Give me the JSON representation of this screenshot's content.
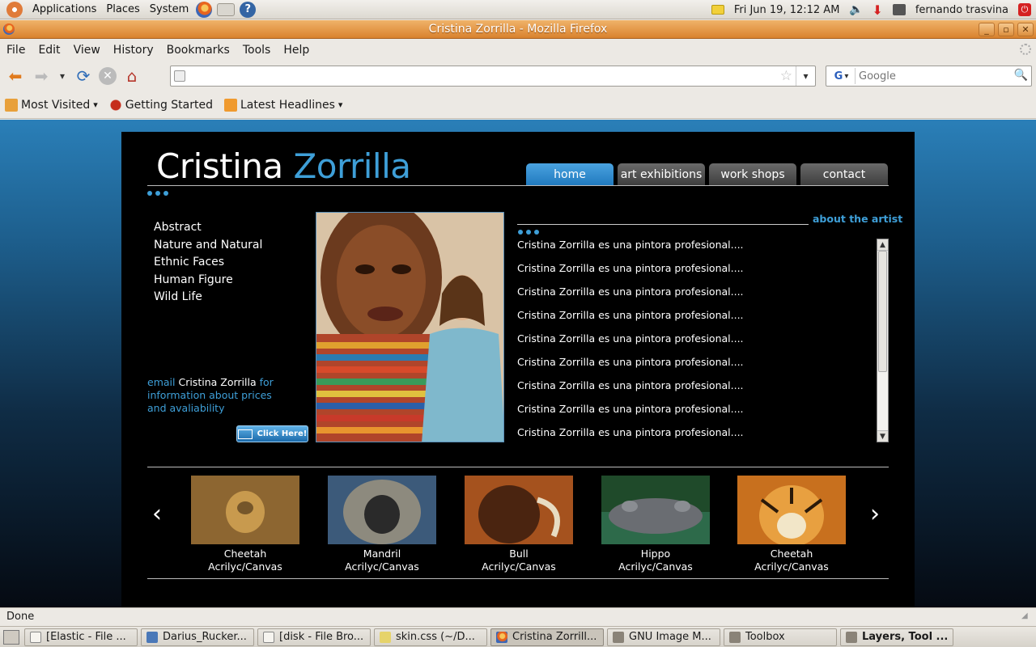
{
  "panel": {
    "menus": [
      "Applications",
      "Places",
      "System"
    ],
    "clock": "Fri Jun 19, 12:12 AM",
    "user": "fernando trasvina"
  },
  "window": {
    "title": "Cristina Zorrilla - Mozilla Firefox",
    "menu": [
      "File",
      "Edit",
      "View",
      "History",
      "Bookmarks",
      "Tools",
      "Help"
    ]
  },
  "nav": {
    "url": "",
    "search_placeholder": "Google",
    "search_engine": "G"
  },
  "bookmarks": [
    {
      "label": "Most Visited",
      "icon": "most-visited-icon",
      "dropdown": true
    },
    {
      "label": "Getting Started",
      "icon": "getting-started-icon",
      "dropdown": false
    },
    {
      "label": "Latest Headlines",
      "icon": "rss-icon",
      "dropdown": true
    }
  ],
  "site": {
    "logo_first": "Cristina",
    "logo_last": "Zorrilla",
    "tabs": [
      "home",
      "art exhibitions",
      "work shops",
      "contact"
    ],
    "active_tab": "home",
    "categories": [
      "Abstract",
      "Nature and Natural",
      "Ethnic Faces",
      "Human Figure",
      "Wild Life"
    ],
    "email_label": "email",
    "email_name": "Cristina Zorrilla",
    "email_rest": "for information about prices and avaliability",
    "click_button": "Click Here!",
    "about_title": "about the artist",
    "about_lines": [
      "Cristina Zorrilla es una pintora profesional....",
      "Cristina Zorrilla es una pintora profesional....",
      "Cristina Zorrilla es una pintora profesional....",
      "Cristina Zorrilla es una pintora profesional....",
      "Cristina Zorrilla es una pintora profesional....",
      "Cristina Zorrilla es una pintora profesional....",
      "Cristina Zorrilla es una pintora profesional....",
      "Cristina Zorrilla es una pintora profesional....",
      "Cristina Zorrilla es una pintora profesional...."
    ],
    "gallery": [
      {
        "title": "Cheetah",
        "medium": "Acrilyc/Canvas",
        "colors": [
          "#6b4a22",
          "#b78a44",
          "#3d2a12"
        ]
      },
      {
        "title": "Mandril",
        "medium": "Acrilyc/Canvas",
        "colors": [
          "#3c5a7a",
          "#8d8a7e",
          "#2a2a2a"
        ]
      },
      {
        "title": "Bull",
        "medium": "Acrilyc/Canvas",
        "colors": [
          "#4a2410",
          "#a5521e",
          "#d68c36"
        ]
      },
      {
        "title": "Hippo",
        "medium": "Acrilyc/Canvas",
        "colors": [
          "#1f4a2a",
          "#6a6d72",
          "#2d7a3a"
        ]
      },
      {
        "title": "Cheetah",
        "medium": "Acrilyc/Canvas",
        "colors": [
          "#c8701e",
          "#f2e6c8",
          "#2a1a0a"
        ]
      }
    ]
  },
  "status": "Done",
  "taskbar": [
    {
      "label": "[Elastic - File ...",
      "icon": "file-browser-icon",
      "active": false,
      "bold": false
    },
    {
      "label": "Darius_Rucker...",
      "icon": "music-player-icon",
      "active": false,
      "bold": false
    },
    {
      "label": "[disk - File Bro...",
      "icon": "file-browser-icon",
      "active": false,
      "bold": false
    },
    {
      "label": "skin.css (~/D...",
      "icon": "text-editor-icon",
      "active": false,
      "bold": false
    },
    {
      "label": "Cristina Zorrill...",
      "icon": "firefox-icon",
      "active": true,
      "bold": false
    },
    {
      "label": "GNU Image M...",
      "icon": "gimp-icon",
      "active": false,
      "bold": false
    },
    {
      "label": "Toolbox",
      "icon": "gimp-icon",
      "active": false,
      "bold": false
    },
    {
      "label": "Layers, Tool ...",
      "icon": "gimp-icon",
      "active": false,
      "bold": true
    }
  ]
}
